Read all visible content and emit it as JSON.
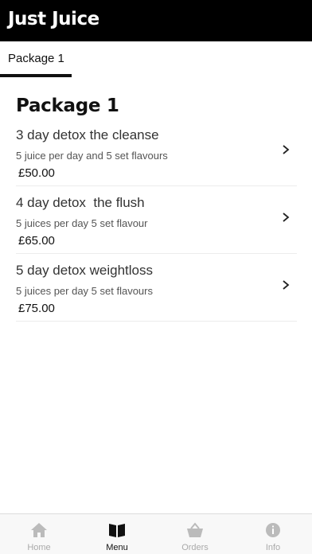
{
  "app": {
    "title": "Just Juice"
  },
  "tabs": [
    {
      "label": "Package 1",
      "active": true
    }
  ],
  "section": {
    "title": "Package 1",
    "items": [
      {
        "name": "3 day detox the cleanse",
        "description": "5 juice per day and 5 set flavours",
        "price": "£50.00"
      },
      {
        "name": "4 day detox  the flush",
        "description": "5 juices per day 5 set flavour",
        "price": "£65.00"
      },
      {
        "name": "5 day detox weightloss",
        "description": "5 juices per day 5 set flavours",
        "price": "£75.00"
      }
    ]
  },
  "bottom_nav": {
    "items": [
      {
        "label": "Home",
        "icon": "home-icon",
        "active": false
      },
      {
        "label": "Menu",
        "icon": "menu-book-icon",
        "active": true
      },
      {
        "label": "Orders",
        "icon": "orders-basket-icon",
        "active": false
      },
      {
        "label": "Info",
        "icon": "info-icon",
        "active": false
      }
    ]
  },
  "colors": {
    "header_bg": "#000000",
    "active": "#111111",
    "inactive": "#aaaaaa"
  }
}
